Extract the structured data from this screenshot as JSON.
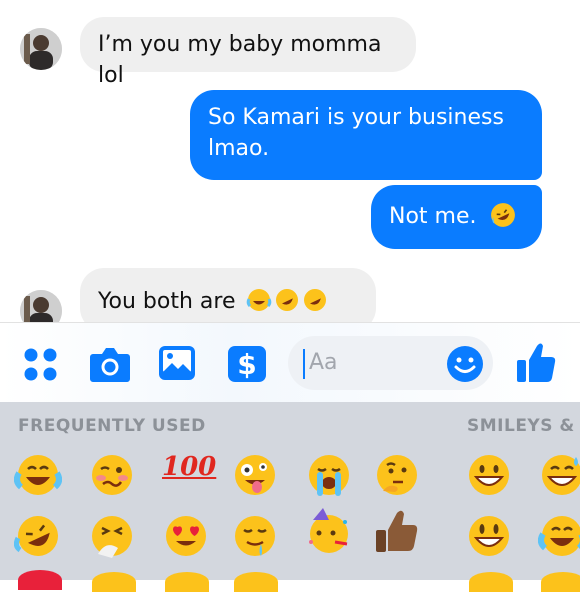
{
  "messages": [
    {
      "from": "them",
      "text": "I’m you my baby momma lol"
    },
    {
      "from": "me",
      "text": "So Kamari is your business lmao."
    },
    {
      "from": "me",
      "text": "Not me.",
      "emoji": "rolling-on-floor-laughing"
    },
    {
      "from": "them",
      "text": "You both are",
      "emoji": [
        "face-with-tears-of-joy",
        "rolling-on-floor-laughing",
        "rolling-on-floor-laughing"
      ]
    }
  ],
  "composer": {
    "placeholder": "Aa"
  },
  "toolbar": {
    "icons": [
      "apps-icon",
      "camera-icon",
      "photo-icon",
      "payment-icon",
      "smiley-icon",
      "thumbs-up-icon"
    ]
  },
  "emoji_keyboard": {
    "sections": [
      "FREQUENTLY USED",
      "SMILEYS & P"
    ],
    "row1": [
      "face-with-tears-of-joy",
      "woozy-face",
      "hundred-points",
      "zany-face",
      "loudly-crying-face",
      "thinking-face",
      "grinning-face",
      "grinning-face-with-sweat"
    ],
    "row1_text": {
      "hundred": "100"
    },
    "row2": [
      "rolling-on-floor-laughing",
      "sneezing-face",
      "heart-eyes",
      "drooling-face",
      "partying-face",
      "thumbs-up-dark",
      "grinning-face-big-eyes",
      "face-with-tears-of-joy"
    ]
  },
  "colors": {
    "accent": "#0a7cff",
    "incoming_bubble": "#efefef",
    "emoji_bg": "#d3d7de"
  }
}
